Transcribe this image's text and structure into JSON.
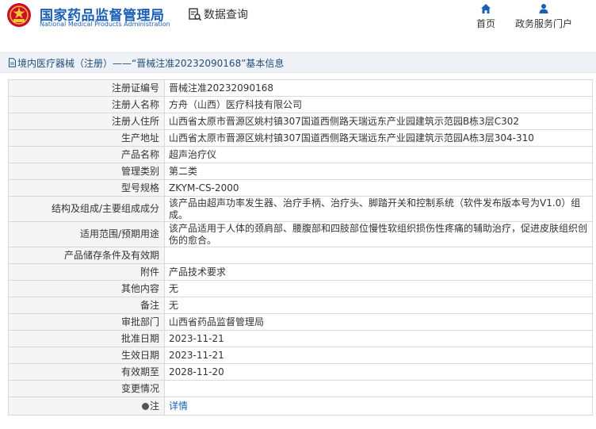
{
  "header": {
    "org_name_cn": "国家药品监督管理局",
    "org_name_en": "National Medical Products Administration",
    "query_label": "数据查询",
    "nav": [
      {
        "label": "首页",
        "icon": "home-icon"
      },
      {
        "label": "政务服务门户",
        "icon": "user-icon"
      }
    ]
  },
  "breadcrumb": {
    "text": "境内医疗器械（注册）——“晋械注准20232090168”基本信息",
    "icon": "document-icon"
  },
  "details": {
    "rows": [
      {
        "label": "注册证编号",
        "value": "晋械注准20232090168"
      },
      {
        "label": "注册人名称",
        "value": "方舟（山西）医疗科技有限公司"
      },
      {
        "label": "注册人住所",
        "value": "山西省太原市晋源区姚村镇307国道西侧路天瑞远东产业园建筑示范园B栋3层C302"
      },
      {
        "label": "生产地址",
        "value": "山西省太原市晋源区姚村镇307国道西侧路天瑞远东产业园建筑示范园A栋3层304-310"
      },
      {
        "label": "产品名称",
        "value": "超声治疗仪"
      },
      {
        "label": "管理类别",
        "value": "第二类"
      },
      {
        "label": "型号规格",
        "value": "ZKYM-CS-2000"
      },
      {
        "label": "结构及组成/主要组成成分",
        "value": "该产品由超声功率发生器、治疗手柄、治疗头、脚踏开关和控制系统（软件发布版本号为V1.0）组成。"
      },
      {
        "label": "适用范围/预期用途",
        "value": "该产品适用于人体的颈肩部、腰腹部和四肢部位慢性软组织损伤性疼痛的辅助治疗，促进皮肤组织创伤的愈合。"
      },
      {
        "label": "产品储存条件及有效期",
        "value": ""
      },
      {
        "label": "附件",
        "value": "产品技术要求"
      },
      {
        "label": "其他内容",
        "value": "无"
      },
      {
        "label": "备注",
        "value": "无"
      },
      {
        "label": "审批部门",
        "value": "山西省药品监督管理局"
      },
      {
        "label": "批准日期",
        "value": "2023-11-21"
      },
      {
        "label": "生效日期",
        "value": "2023-11-21"
      },
      {
        "label": "有效期至",
        "value": "2028-11-20"
      },
      {
        "label": "变更情况",
        "value": ""
      }
    ],
    "note_row": {
      "label": "注",
      "link_text": "详情"
    }
  },
  "colors": {
    "brand_blue": "#1a5fb4",
    "label_bg": "#f5f5f5",
    "breadcrumb_bg": "#eef2f6"
  }
}
